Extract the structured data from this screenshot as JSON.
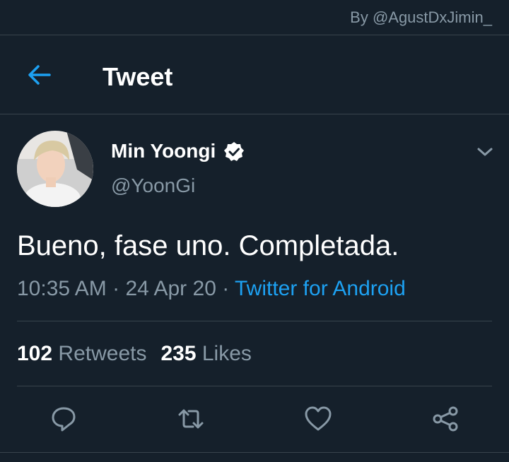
{
  "watermark": "By @AgustDxJimin_",
  "header": {
    "title": "Tweet",
    "back_icon": "arrow-left-icon"
  },
  "tweet": {
    "display_name": "Min Yoongi",
    "verified": true,
    "handle": "@YoonGi",
    "text": "Bueno, fase uno. Completada.",
    "time": "10:35 AM",
    "date": "24 Apr 20",
    "source": "Twitter for Android",
    "separator": " · "
  },
  "stats": {
    "retweets_count": "102",
    "retweets_label": "Retweets",
    "likes_count": "235",
    "likes_label": "Likes"
  },
  "actions": [
    "reply-icon",
    "retweet-icon",
    "like-icon",
    "share-icon"
  ],
  "colors": {
    "background": "#15202b",
    "accent": "#1da1f2",
    "secondary_text": "#8899a6",
    "divider": "#38444d"
  }
}
